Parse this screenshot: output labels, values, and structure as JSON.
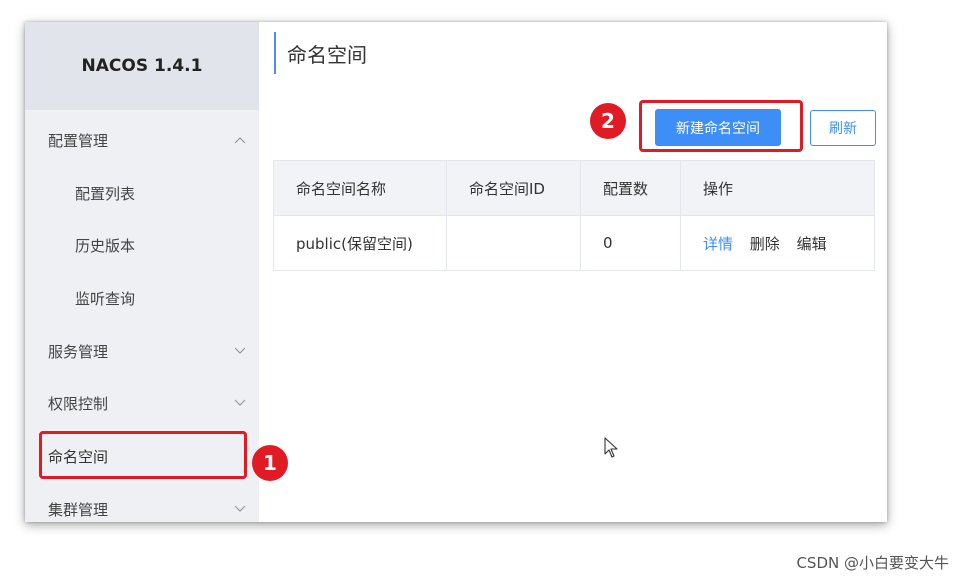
{
  "app": {
    "logo": "NACOS 1.4.1"
  },
  "sidebar": {
    "items": [
      {
        "label": "配置管理",
        "chevron": "up"
      },
      {
        "label": "配置列表"
      },
      {
        "label": "历史版本"
      },
      {
        "label": "监听查询"
      },
      {
        "label": "服务管理",
        "chevron": "down"
      },
      {
        "label": "权限控制",
        "chevron": "down"
      },
      {
        "label": "命名空间",
        "active": true
      },
      {
        "label": "集群管理",
        "chevron": "down"
      }
    ]
  },
  "main": {
    "title": "命名空间",
    "buttons": {
      "create": "新建命名空间",
      "refresh": "刷新"
    },
    "table": {
      "headers": [
        "命名空间名称",
        "命名空间ID",
        "配置数",
        "操作"
      ],
      "rows": [
        {
          "name": "public(保留空间)",
          "id": "",
          "count": "0",
          "ops": [
            "详情",
            "删除",
            "编辑"
          ]
        }
      ]
    }
  },
  "annotations": {
    "one": "1",
    "two": "2",
    "color": "#e01b24"
  },
  "colors": {
    "accent": "#3e8ef7",
    "sidebar_bg": "#eef0f4"
  },
  "watermark": "CSDN @小白要变大牛"
}
